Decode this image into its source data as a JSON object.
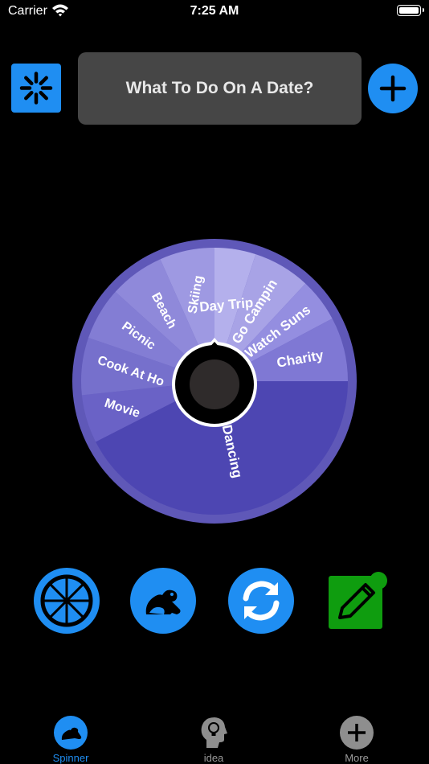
{
  "status": {
    "carrier": "Carrier",
    "time": "7:25 AM"
  },
  "header": {
    "title": "What To Do On A Date?"
  },
  "wheel": {
    "segments": [
      "Day Trip",
      "Go Camping",
      "Watch Sunset",
      "Charity",
      "Dancing",
      "Movie",
      "Cook At Home",
      "Picnic",
      "Beach",
      "Skiing"
    ],
    "shown_labels": [
      "Day Trip",
      "Go Campin",
      "Watch Suns",
      "Charity",
      "Dancing",
      "Movie",
      "Cook At Ho",
      "Picnic",
      "Beach",
      "Skiing"
    ]
  },
  "tabs": [
    {
      "label": "Spinner",
      "active": true,
      "icon": "frog-icon"
    },
    {
      "label": "idea",
      "active": false,
      "icon": "lightbulb-head-icon"
    },
    {
      "label": "More",
      "active": false,
      "icon": "plus-circle-icon"
    }
  ],
  "colors": {
    "accent": "#1f8ef2",
    "green": "#0f9d0f",
    "wheel_dark": "#4a43b0"
  }
}
